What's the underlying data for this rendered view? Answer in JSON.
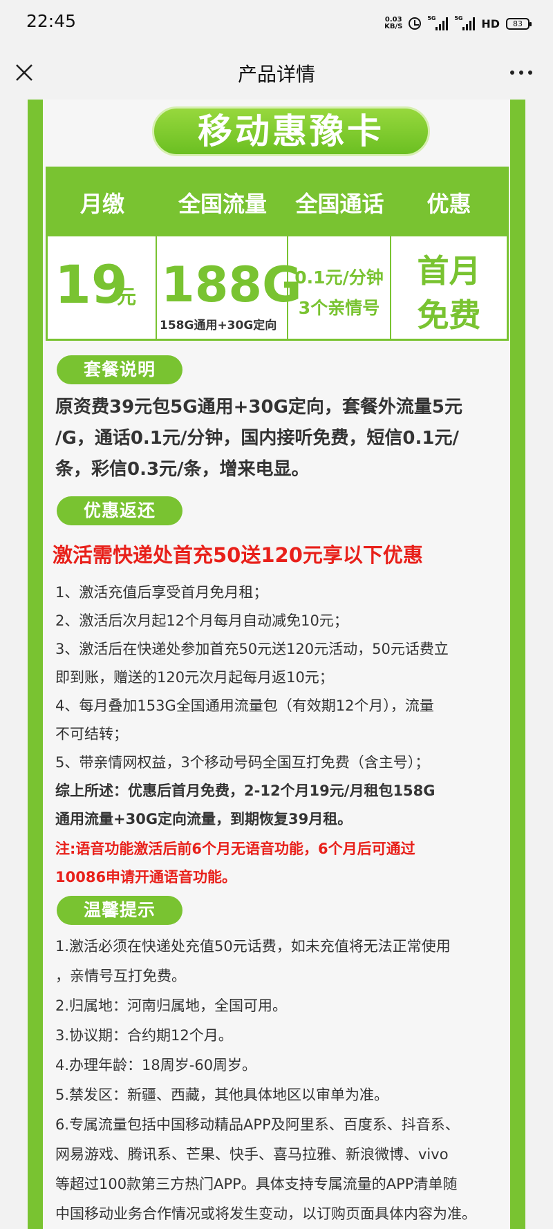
{
  "status_bar": {
    "time": "22:45",
    "net_speed_value": "0.03",
    "net_speed_unit": "KB/S",
    "signal1_label": "5G",
    "signal2_label": "5G",
    "hd_label": "HD",
    "battery": "83"
  },
  "header": {
    "title": "产品详情",
    "close_icon": "close-icon",
    "more_icon": "more-icon"
  },
  "poster": {
    "title": "移动惠豫卡",
    "columns": [
      "月缴",
      "全国流量",
      "全国通话",
      "优惠"
    ],
    "monthly_value": "19",
    "monthly_unit": "元",
    "data_value": "188G",
    "data_sub": "158G通用+30G定向",
    "call_line1": "0.1元/分钟",
    "call_line2": "3个亲情号",
    "promo_line1": "首月",
    "promo_line2": "免费",
    "section1_title": "套餐说明",
    "section1_lines": [
      "原资费39元包5G通用+30G定向，套餐外流量5元",
      "/G，通话0.1元/分钟，国内接听免费，短信0.1元/",
      "条，彩信0.3元/条，增来电显。"
    ],
    "section2_title": "优惠返还",
    "section2_headline": "激活需快递处首充50送120元享以下优惠",
    "section2_lines": [
      "1、激活充值后享受首月免月租；",
      "2、激活后次月起12个月每月自动减免10元；",
      "3、激活后在快递处参加首充50元送120元活动，50元话费立",
      "即到账，赠送的120元次月起每月返10元；",
      "4、每月叠加153G全国通用流量包（有效期12个月），流量",
      "不可结转；",
      "5、带亲情网权益，3个移动号码全国互打免费（含主号）；",
      "综上所述：优惠后首月免费，2-12个月19元/月租包158G",
      "通用流量+30G定向流量，到期恢复39月租。"
    ],
    "section2_note": [
      "注:语音功能激活后前6个月无语音功能，6个月后可通过",
      "10086申请开通语音功能。"
    ],
    "section3_title": "温馨提示",
    "section3_lines": [
      "1.激活必须在快递处充值50元话费，如未充值将无法正常使用",
      "，亲情号互打免费。",
      "2.归属地：河南归属地，全国可用。",
      "3.协议期：合约期12个月。",
      "4.办理年龄：18周岁-60周岁。",
      "5.禁发区：新疆、西藏，其他具体地区以审单为准。",
      "6.专属流量包括中国移动精品APP及阿里系、百度系、抖音系、",
      "网易游戏、腾讯系、芒果、快手、喜马拉雅、新浪微博、vivo",
      "等超过100款第三方热门APP。具体支持专属流量的APP清单随",
      "中国移动业务合作情况或将发生变动，以订购页面具体内容为准。"
    ],
    "colors": {
      "green": "#79c331",
      "red": "#e8201a"
    }
  }
}
